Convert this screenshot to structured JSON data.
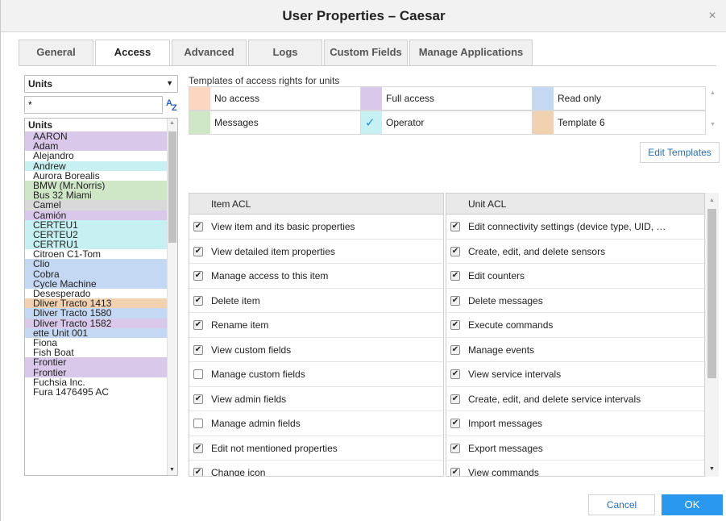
{
  "window": {
    "title": "User Properties – Caesar",
    "close_glyph": "×"
  },
  "tabs": [
    {
      "label": "General",
      "active": false
    },
    {
      "label": "Access",
      "active": true
    },
    {
      "label": "Advanced",
      "active": false
    },
    {
      "label": "Logs",
      "active": false
    },
    {
      "label": "Custom Fields",
      "active": false
    },
    {
      "label": "Manage Applications",
      "active": false
    }
  ],
  "left_panel": {
    "type_select": {
      "value": "Units",
      "arrow": "▼"
    },
    "filter": {
      "value": "*",
      "sort_icon": "sort-alpha-icon",
      "sort_a": "A",
      "sort_z": "Z"
    },
    "list_header": "Units",
    "units": [
      {
        "name": "AARON",
        "color": "#d9c8ea"
      },
      {
        "name": "Adam",
        "color": "#d9c8ea"
      },
      {
        "name": "Alejandro",
        "color": "#ffffff"
      },
      {
        "name": "Andrew",
        "color": "#c6f0f2"
      },
      {
        "name": "Aurora Borealis",
        "color": "#ffffff"
      },
      {
        "name": "BMW (Mr.Norris)",
        "color": "#cfe7c7"
      },
      {
        "name": "Bus 32 Miami",
        "color": "#cfe7c7"
      },
      {
        "name": "Camel",
        "color": "#d9d9d9"
      },
      {
        "name": "Camión",
        "color": "#d9c8ea"
      },
      {
        "name": "CERTEU1",
        "color": "#c6f0f2"
      },
      {
        "name": "CERTEU2",
        "color": "#c6f0f2"
      },
      {
        "name": "CERTRU1",
        "color": "#c6f0f2"
      },
      {
        "name": "Citroen C1-Tom",
        "color": "#ffffff"
      },
      {
        "name": "Clio",
        "color": "#c5d8f3"
      },
      {
        "name": "Cobra",
        "color": "#c5d8f3"
      },
      {
        "name": "Cycle Machine",
        "color": "#c5d8f3"
      },
      {
        "name": "Desesperado",
        "color": "#ffffff"
      },
      {
        "name": "Dliver Tracto 1413",
        "color": "#f1d1b0"
      },
      {
        "name": "Dliver Tracto 1580",
        "color": "#c5d8f3"
      },
      {
        "name": "Dliver Tracto 1582",
        "color": "#d9c8ea"
      },
      {
        "name": "ette Unit 001",
        "color": "#c5d8f3"
      },
      {
        "name": "Fiona",
        "color": "#ffffff"
      },
      {
        "name": "Fish Boat",
        "color": "#ffffff"
      },
      {
        "name": "Frontier",
        "color": "#d9c8ea"
      },
      {
        "name": "Frontier",
        "color": "#d9c8ea"
      },
      {
        "name": "Fuchsia Inc.",
        "color": "#ffffff"
      },
      {
        "name": "Fura 1476495 AC",
        "color": "#ffffff"
      }
    ]
  },
  "templates": {
    "label": "Templates of access rights for units",
    "items": [
      {
        "name": "No access",
        "color": "#fcd6c0",
        "selected": false
      },
      {
        "name": "Full access",
        "color": "#d9c8ea",
        "selected": false
      },
      {
        "name": "Read only",
        "color": "#c5d8f3",
        "selected": false
      },
      {
        "name": "Messages",
        "color": "#cfe7c7",
        "selected": false
      },
      {
        "name": "Operator",
        "color": "#c6f0f2",
        "selected": true
      },
      {
        "name": "Template 6",
        "color": "#f1d1b0",
        "selected": false
      }
    ],
    "edit_button": "Edit Templates",
    "check_glyph": "✓"
  },
  "item_acl": {
    "header": "Item ACL",
    "rows": [
      {
        "label": "View item and its basic properties",
        "checked": true
      },
      {
        "label": "View detailed item properties",
        "checked": true
      },
      {
        "label": "Manage access to this item",
        "checked": true
      },
      {
        "label": "Delete item",
        "checked": true
      },
      {
        "label": "Rename item",
        "checked": true
      },
      {
        "label": "View custom fields",
        "checked": true
      },
      {
        "label": "Manage custom fields",
        "checked": false
      },
      {
        "label": "View admin fields",
        "checked": true
      },
      {
        "label": "Manage admin fields",
        "checked": false
      },
      {
        "label": "Edit not mentioned properties",
        "checked": true
      },
      {
        "label": "Change icon",
        "checked": true
      }
    ]
  },
  "unit_acl": {
    "header": "Unit ACL",
    "rows": [
      {
        "label": "Edit connectivity settings (device type, UID, …",
        "checked": true
      },
      {
        "label": "Create, edit, and delete sensors",
        "checked": true
      },
      {
        "label": "Edit counters",
        "checked": true
      },
      {
        "label": "Delete messages",
        "checked": true
      },
      {
        "label": "Execute commands",
        "checked": true
      },
      {
        "label": "Manage events",
        "checked": true
      },
      {
        "label": "View service intervals",
        "checked": true
      },
      {
        "label": "Create, edit, and delete service intervals",
        "checked": true
      },
      {
        "label": "Import messages",
        "checked": true
      },
      {
        "label": "Export messages",
        "checked": true
      },
      {
        "label": "View commands",
        "checked": true
      }
    ]
  },
  "footer": {
    "cancel_label": "Cancel",
    "ok_label": "OK"
  },
  "glyphs": {
    "up": "▲",
    "down": "▼",
    "check": "✔"
  }
}
